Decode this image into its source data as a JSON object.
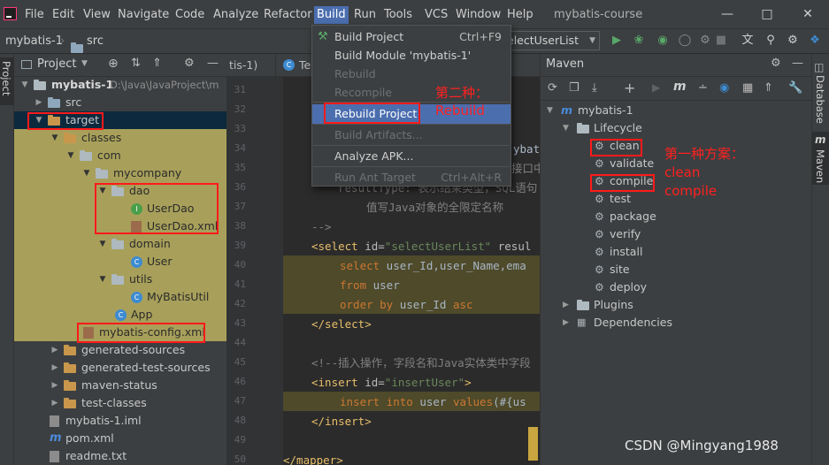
{
  "menubar": {
    "items": [
      "File",
      "Edit",
      "View",
      "Navigate",
      "Code",
      "Analyze",
      "Refactor",
      "Build",
      "Run",
      "Tools",
      "VCS",
      "Window",
      "Help"
    ],
    "window_title": "mybatis-course"
  },
  "navbar": {
    "project": "mybatis-1",
    "folder": "src",
    "run_config": "electUserList"
  },
  "left_stripe": {
    "project_label": "Project"
  },
  "project_panel": {
    "title": "Project",
    "root": {
      "name": "mybatis-1",
      "path": "D:\\Java\\JavaProject\\m"
    },
    "src": "src",
    "target": "target",
    "classes": "classes",
    "com": "com",
    "mycompany": "mycompany",
    "dao": "dao",
    "userdao": "UserDao",
    "userdao_xml": "UserDao.xml",
    "domain": "domain",
    "user": "User",
    "utils": "utils",
    "mybatisutil": "MyBatisUtil",
    "app": "App",
    "config_xml": "mybatis-config.xml",
    "generated_sources": "generated-sources",
    "generated_test_sources": "generated-test-sources",
    "maven_status": "maven-status",
    "test_classes": "test-classes",
    "iml": "mybatis-1.iml",
    "pom": "pom.xml",
    "readme": "readme.txt"
  },
  "editor": {
    "tabs": [
      "tis-1)",
      "Te"
    ],
    "line_numbers": [
      "31",
      "32",
      "33",
      "34",
      "35",
      "36",
      "37",
      "38",
      "39",
      "40",
      "41",
      "42",
      "43",
      "44",
      "45",
      "46",
      "47",
      "48",
      "49",
      "50"
    ],
    "lines": {
      "l34_text": "ybati",
      "l35_text": "接口中",
      "l36_a": "resultType: 表示结果类型，SQL语句",
      "l37_a": "值写Java对象的全限定名称",
      "l38_a": "-->",
      "l39_tag": "<select",
      "l39_attr": " id=",
      "l39_val": "\"selectUserList\"",
      "l39_rest": " resul",
      "l40_kw": "select",
      "l40_rest": " user_Id,user_Name,ema",
      "l41_kw": "from",
      "l41_rest": " user",
      "l42_kw1": "order by",
      "l42_mid": " user_Id ",
      "l42_kw2": "asc",
      "l43_tag": "</select>",
      "l45_comment": "<!--插入操作，字段名和Java实体类中字段",
      "l46_tag": "<insert",
      "l46_attr": " id=",
      "l46_val": "\"insertUser\"",
      "l46_close": ">",
      "l47_kw": "insert into",
      "l47_mid": " user ",
      "l47_kw2": "values",
      "l47_rest": "(#{us",
      "l48_tag": "</insert>",
      "l50_tag": "</mapper>"
    }
  },
  "build_menu": {
    "items": [
      {
        "label": "Build Project",
        "shortcut": "Ctrl+F9",
        "disabled": false
      },
      {
        "label": "Build Module 'mybatis-1'",
        "shortcut": "",
        "disabled": false
      },
      {
        "label": "Rebuild",
        "shortcut": "",
        "disabled": true
      },
      {
        "label": "Recompile",
        "shortcut": "",
        "disabled": true
      },
      {
        "label": "Rebuild Project",
        "shortcut": "",
        "disabled": false
      },
      {
        "label": "Build Artifacts...",
        "shortcut": "",
        "disabled": true
      },
      {
        "label": "Analyze APK...",
        "shortcut": "",
        "disabled": false
      },
      {
        "label": "Run Ant Target",
        "shortcut": "Ctrl+Alt+R",
        "disabled": true
      }
    ]
  },
  "maven": {
    "title": "Maven",
    "project": "mybatis-1",
    "lifecycle": "Lifecycle",
    "goals": [
      "clean",
      "validate",
      "compile",
      "test",
      "package",
      "verify",
      "install",
      "site",
      "deploy"
    ],
    "plugins": "Plugins",
    "dependencies": "Dependencies"
  },
  "right_stripe": {
    "database": "Database",
    "maven": "Maven"
  },
  "annotations": {
    "method2_line1": "第二种：",
    "method2_line2": "Rebuild",
    "method1_line1": "第一种方案：",
    "method1_line2": "clean",
    "method1_line3": "compile"
  },
  "watermark": "CSDN @Mingyang1988",
  "colors": {
    "accent": "#4b6eaf",
    "annotation": "#ff2020",
    "selection": "#0d293e"
  }
}
